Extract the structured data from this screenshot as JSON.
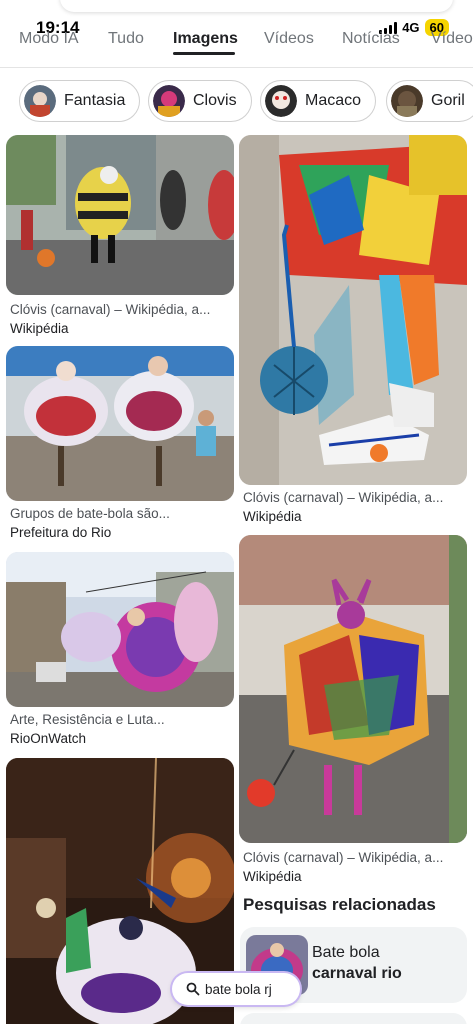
{
  "status": {
    "time": "19:14",
    "network": "4G",
    "battery": "60"
  },
  "tabs": [
    {
      "label": "Modo IA"
    },
    {
      "label": "Tudo"
    },
    {
      "label": "Imagens"
    },
    {
      "label": "Vídeos"
    },
    {
      "label": "Notícias"
    },
    {
      "label": "Vídeo"
    }
  ],
  "chips": [
    {
      "label": "Fantasia"
    },
    {
      "label": "Clovis"
    },
    {
      "label": "Macaco"
    },
    {
      "label": "Goril"
    }
  ],
  "results": [
    {
      "caption": "Clóvis (carnaval) – Wikipédia, a...",
      "source": "Wikipédia"
    },
    {
      "caption": "Clóvis (carnaval) – Wikipédia, a...",
      "source": "Wikipédia"
    },
    {
      "caption": "Grupos de bate-bola são...",
      "source": "Prefeitura do Rio"
    },
    {
      "caption": "Clóvis (carnaval) – Wikipédia, a...",
      "source": "Wikipédia"
    },
    {
      "caption": "Arte, Resistência e Luta...",
      "source": "RioOnWatch"
    }
  ],
  "related": {
    "title": "Pesquisas relacionadas",
    "items": [
      {
        "line1": "Bate bola",
        "line2": "carnaval rio"
      }
    ]
  },
  "floating_search": {
    "label": "bate bola rj",
    "icon": "search-icon"
  },
  "colors": {
    "accent": "#202124",
    "pill_outline": "#c9b8f2",
    "card_bg": "#f1f3f4",
    "battery": "#f5d400"
  }
}
